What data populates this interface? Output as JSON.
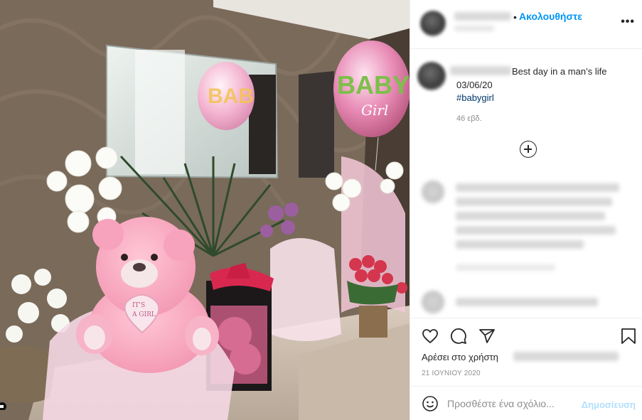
{
  "post": {
    "follow_label": "Ακολουθήστε",
    "more_label": "•••",
    "separator": "•"
  },
  "caption": {
    "text": "Best day in a man’s life",
    "date_line": "03/06/20",
    "hashtag": "#babygirl",
    "time_ago": "46 εβδ."
  },
  "photo": {
    "balloon_left_text": "BAB",
    "balloon_right_text": "BABY",
    "balloon_right_sub": "Girl",
    "bear_tag_line1": "IT'S",
    "bear_tag_line2": "A GIRL"
  },
  "actions": {
    "likes_prefix": "Αρέσει στο χρήστη",
    "date": "21 ΙΟΥΝΙΟΥ 2020"
  },
  "comment_box": {
    "placeholder": "Προσθέστε ένα σχόλιο...",
    "publish_label": "Δημοσίευση"
  },
  "colors": {
    "accent": "#0095f6",
    "publish_disabled": "#b2dffc",
    "hashtag": "#00376b",
    "muted": "#8e8e8e"
  },
  "icons": [
    "heart-icon",
    "comment-icon",
    "share-icon",
    "bookmark-icon",
    "emoji-icon",
    "plus-circle-icon",
    "more-icon",
    "multi-photo-icon"
  ]
}
